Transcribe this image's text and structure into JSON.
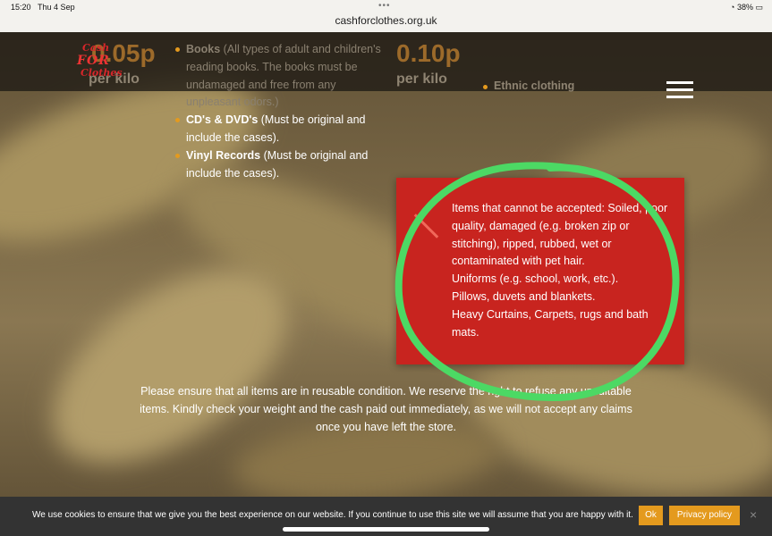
{
  "status": {
    "time": "15:20",
    "date": "Thu 4 Sep",
    "battery": "38%",
    "url": "cashforclothes.org.uk"
  },
  "logo": {
    "line1": "Cash",
    "line2": "FOR",
    "line3": "Clothes"
  },
  "prices": {
    "left_value": "0.05p",
    "left_unit": "per kilo",
    "right_value": "0.10p",
    "right_unit": "per kilo"
  },
  "bullets": [
    {
      "bold": "Books",
      "rest": " (All types of adult and children's reading books. The books must be undamaged and free from any unpleasant odors.)"
    },
    {
      "bold": "CD's & DVD's",
      "rest": " (Must be original and include the cases)."
    },
    {
      "bold": "Vinyl Records",
      "rest": " (Must be original and include the cases)."
    }
  ],
  "ethnic": "Ethnic clothing",
  "panel": {
    "lines": [
      "Items that cannot be accepted: Soiled, poor quality, damaged (e.g. broken zip or stitching), ripped, rubbed, wet or contaminated with pet hair.",
      "Uniforms (e.g. school, work, etc.).",
      "Pillows, duvets and blankets.",
      "Heavy Curtains, Carpets, rugs and bath mats."
    ]
  },
  "notice": "Please ensure that all items are in reusable condition. We reserve the right to refuse any unsuitable items. Kindly check your weight and the cash paid out immediately, as we will not accept any claims once you have left the store.",
  "cookie": {
    "message": "We use cookies to ensure that we give you the best experience on our website. If you continue to use this site we will assume that you are happy with it.",
    "ok": "Ok",
    "privacy": "Privacy policy",
    "close": "×"
  },
  "colors": {
    "accent": "#e49a1e",
    "panel": "#c8241f",
    "annotation": "#4cd964"
  }
}
